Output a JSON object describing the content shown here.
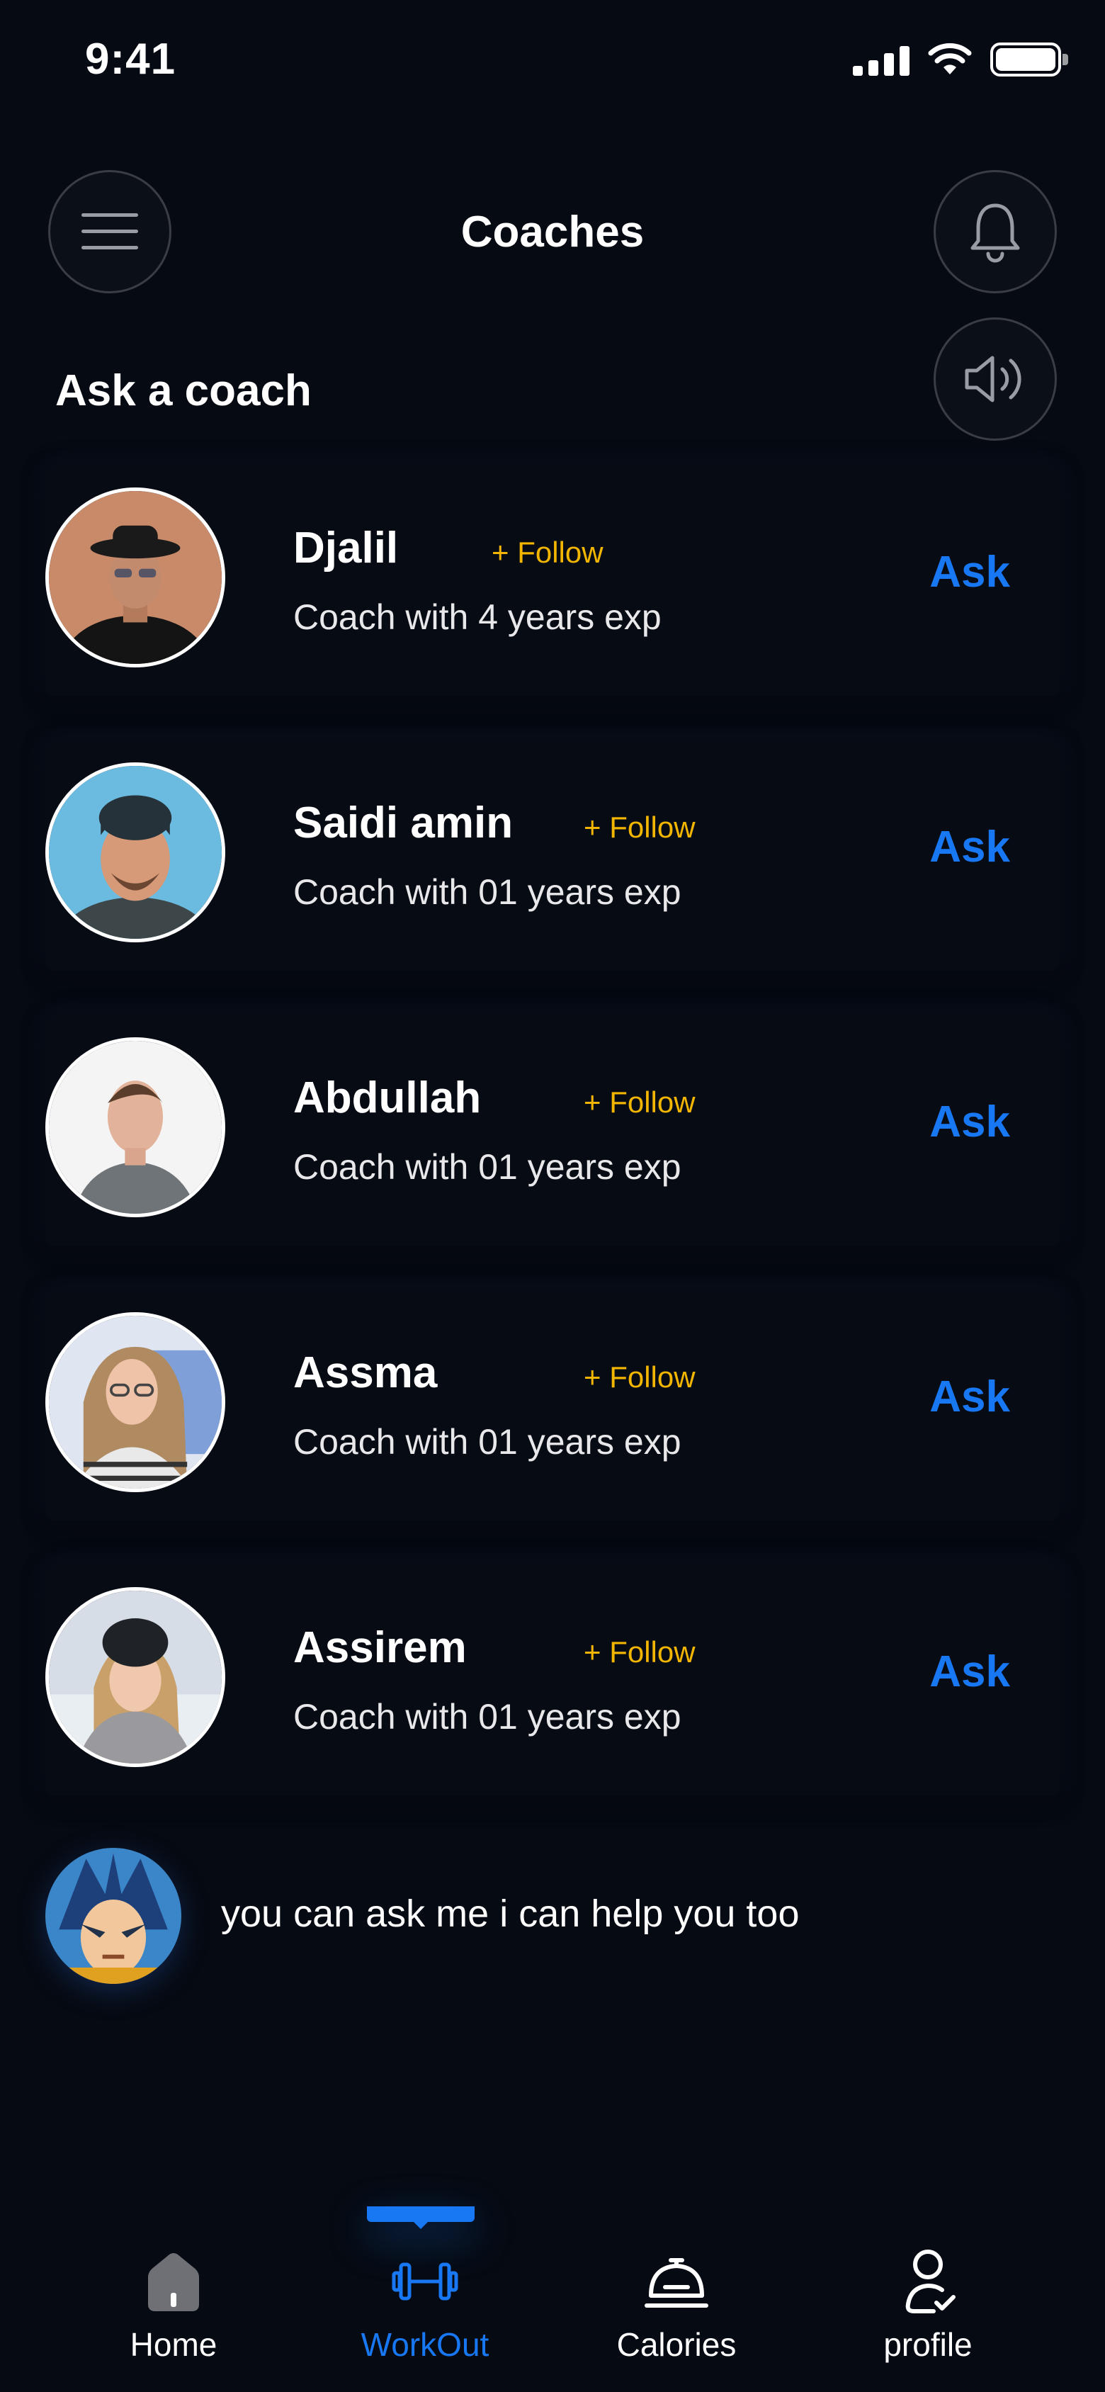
{
  "status_bar": {
    "time": "9:41"
  },
  "header": {
    "title": "Coaches"
  },
  "section": {
    "title": "Ask a coach"
  },
  "coaches": [
    {
      "name": "Djalil",
      "follow": "+ Follow",
      "subtitle": "Coach with 4 years exp",
      "ask": "Ask"
    },
    {
      "name": "Saidi amin",
      "follow": "+ Follow",
      "subtitle": "Coach with 01 years exp",
      "ask": "Ask"
    },
    {
      "name": "Abdullah",
      "follow": "+ Follow",
      "subtitle": "Coach with 01 years exp",
      "ask": "Ask"
    },
    {
      "name": "Assma",
      "follow": "+ Follow",
      "subtitle": "Coach with 01 years exp",
      "ask": "Ask"
    },
    {
      "name": "Assirem",
      "follow": "+ Follow",
      "subtitle": "Coach with 01 years exp",
      "ask": "Ask"
    }
  ],
  "bot": {
    "message": "you can ask me i can help you too"
  },
  "nav": {
    "items": [
      {
        "label": "Home",
        "icon": "home-icon"
      },
      {
        "label": "WorkOut",
        "icon": "dumbbell-icon",
        "active": true
      },
      {
        "label": "Calories",
        "icon": "food-cloche-icon"
      },
      {
        "label": "profile",
        "icon": "user-check-icon"
      }
    ]
  },
  "colors": {
    "background": "#060a12",
    "accent": "#1877f2",
    "follow": "#f2b500",
    "card": "#070b13"
  }
}
